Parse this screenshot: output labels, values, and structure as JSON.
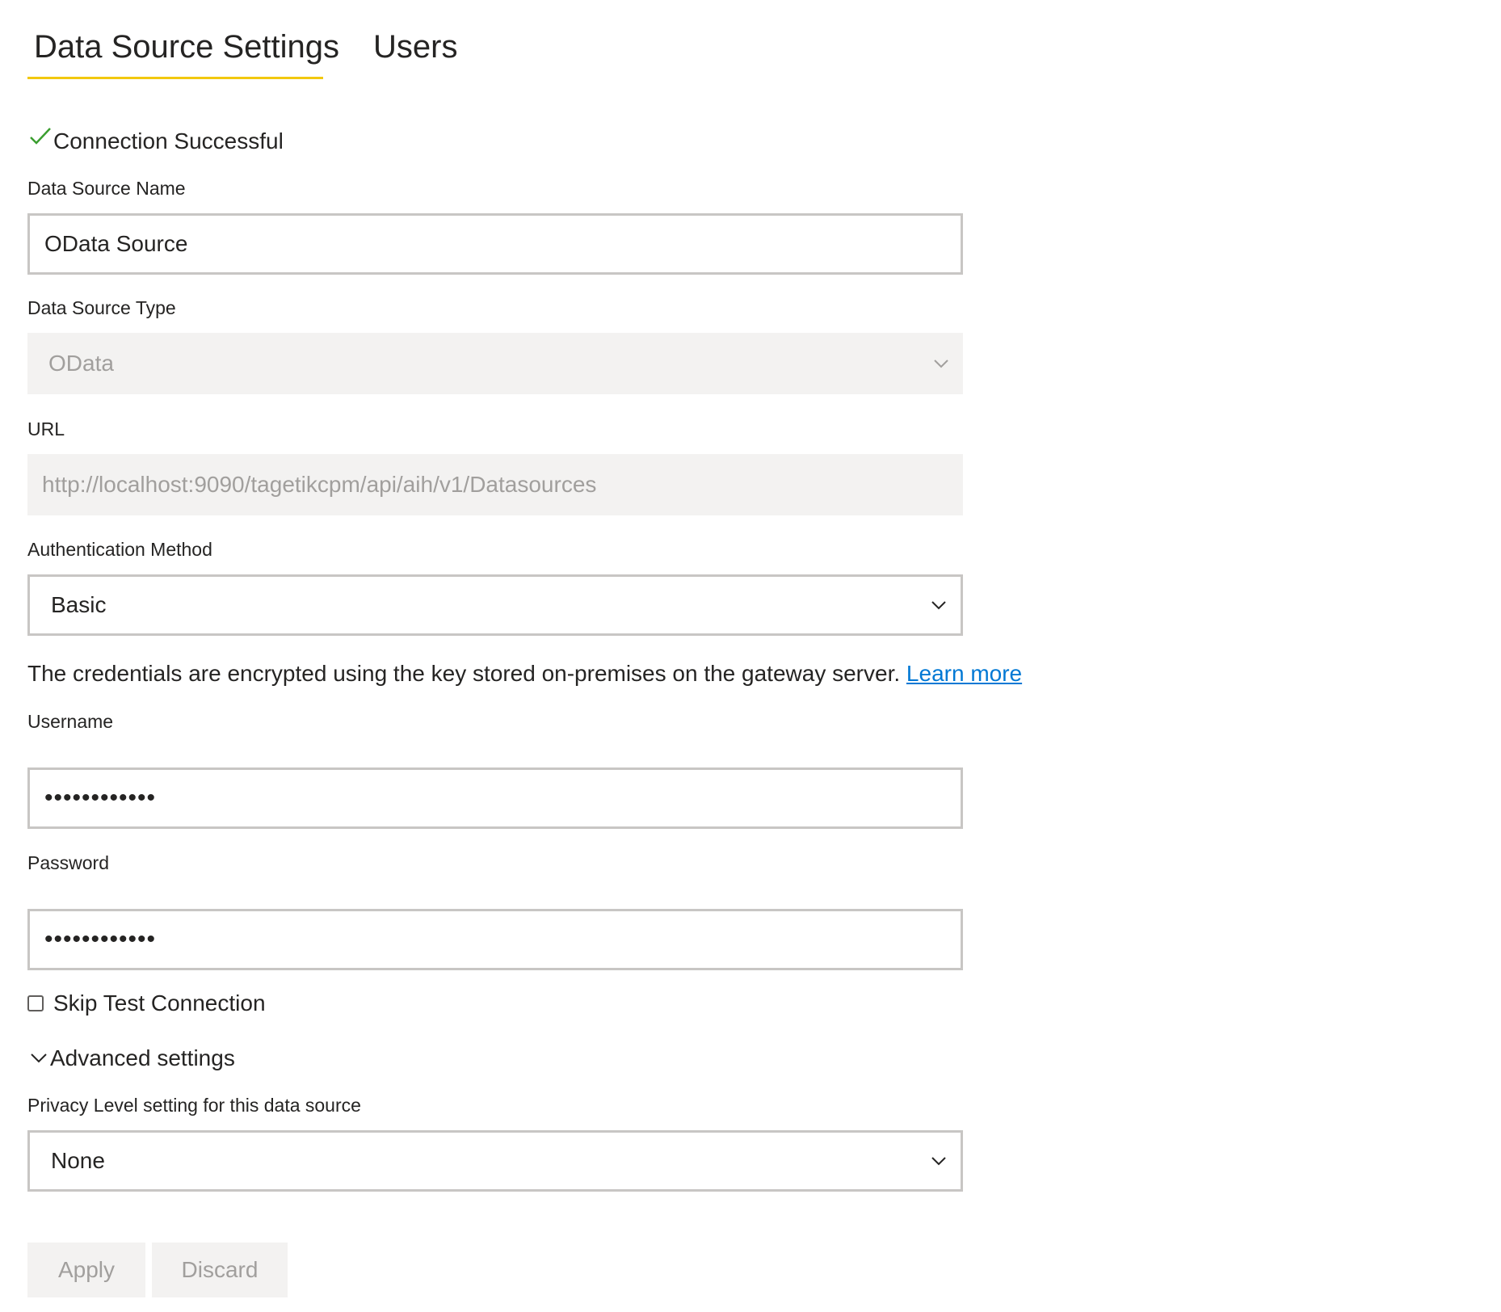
{
  "tabs": [
    {
      "label": "Data Source Settings",
      "active": true
    },
    {
      "label": "Users",
      "active": false
    }
  ],
  "status": {
    "text": "Connection Successful",
    "icon": "check-icon",
    "color": "#3a9e2f"
  },
  "form": {
    "name_label": "Data Source Name",
    "name_value": "OData Source",
    "type_label": "Data Source Type",
    "type_value": "OData",
    "url_label": "URL",
    "url_value": "http://localhost:9090/tagetikcpm/api/aih/v1/Datasources",
    "auth_label": "Authentication Method",
    "auth_value": "Basic",
    "credentials_note": "The credentials are encrypted using the key stored on-premises on the gateway server.",
    "learn_more": "Learn more",
    "username_label": "Username",
    "username_value": "••••••••••••",
    "password_label": "Password",
    "password_value": "••••••••••••",
    "skip_test_label": "Skip Test Connection",
    "skip_test_checked": false,
    "advanced_label": "Advanced settings",
    "privacy_label": "Privacy Level setting for this data source",
    "privacy_value": "None"
  },
  "buttons": {
    "apply": "Apply",
    "discard": "Discard"
  },
  "colors": {
    "tab_underline": "#f2c80f",
    "link": "#0078d4",
    "disabled_bg": "#f3f2f1",
    "disabled_text": "#a19f9d",
    "border": "#c8c6c4"
  }
}
